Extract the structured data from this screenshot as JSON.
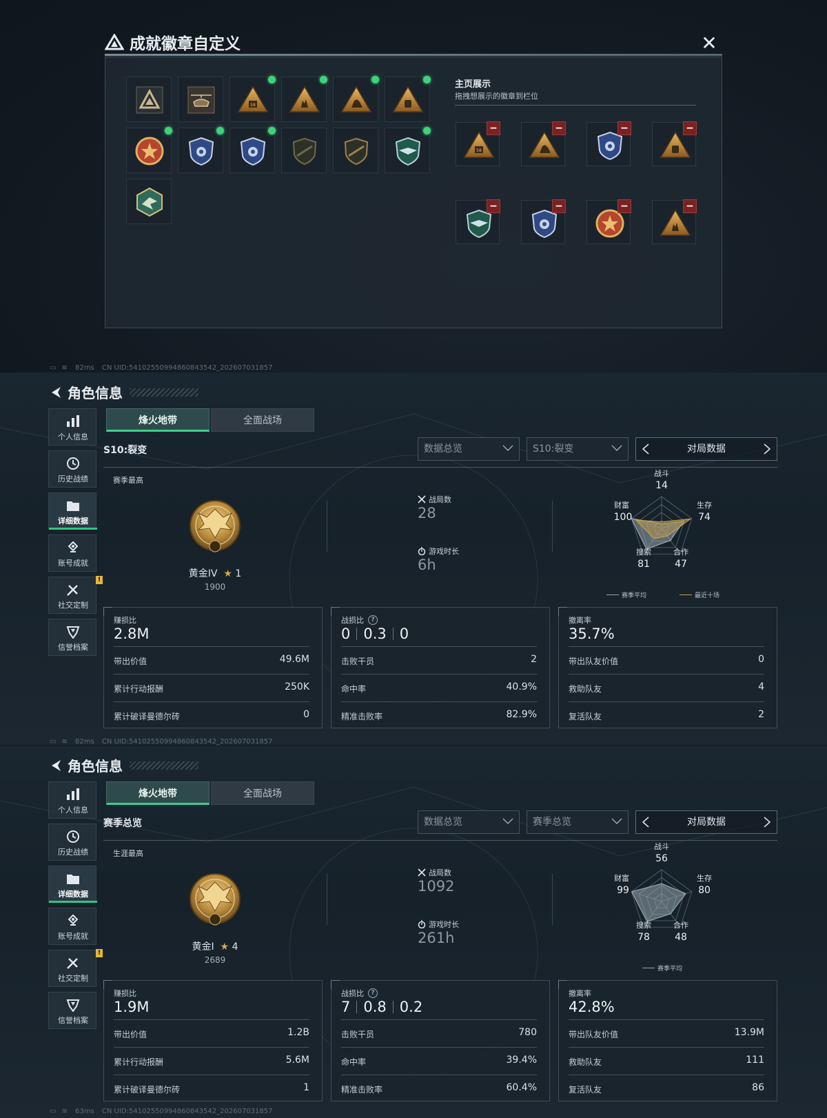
{
  "badge_dialog": {
    "title": "成就徽章自定义",
    "close_glyph": "✕",
    "showcase_title": "主页展示",
    "showcase_hint": "拖拽想展示的徽章到栏位",
    "owned": [
      {
        "icon": "triangle-emblem-icon",
        "equipped": false
      },
      {
        "icon": "helicopter-emblem-icon",
        "equipped": false
      },
      {
        "icon": "backpack-58-triangle-icon",
        "equipped": true
      },
      {
        "icon": "hand-sign-triangle-icon",
        "equipped": true
      },
      {
        "icon": "soldier-triangle-icon",
        "equipped": true
      },
      {
        "icon": "armor-triangle-icon",
        "equipped": true
      },
      {
        "icon": "star-medal-icon",
        "equipped": true
      },
      {
        "icon": "blue-shield-icon",
        "equipped": true
      },
      {
        "icon": "blue-shield-wings-icon",
        "equipped": true
      },
      {
        "icon": "rifle-shield-icon",
        "equipped": false
      },
      {
        "icon": "rifle-shield-gold-icon",
        "equipped": false
      },
      {
        "icon": "green-wings-shield-icon",
        "equipped": true
      },
      {
        "icon": "green-hex-bird-icon",
        "equipped": false
      }
    ],
    "display_slots": [
      "backpack-58-triangle-icon",
      "soldier-triangle-icon",
      "blue-shield-wings-icon",
      "armor-triangle-icon",
      "green-wings-shield-icon",
      "blue-shield-icon",
      "star-medal-icon",
      "hand-sign-triangle-icon"
    ],
    "remove_glyph": "−"
  },
  "status_bars": [
    {
      "ping": "82ms",
      "uid": "CN UID:5410255099486084354​2_202607031857"
    },
    {
      "ping": "82ms",
      "uid": "CN UID:54102550994860843542_202607031857"
    },
    {
      "ping": "63ms",
      "uid": "CN UID:54102550994860843542_202607031857"
    }
  ],
  "colors": {
    "accent": "#2fc783",
    "gold": "#d5a948",
    "danger": "#7a2222",
    "radar_season": "#9aa6ae",
    "radar_recent": "#c9a24a"
  },
  "panes": [
    {
      "header_title": "角色信息",
      "nav": [
        "个人信息",
        "历史战绩",
        "详细数据",
        "账号成就",
        "社交定制",
        "信誉档案"
      ],
      "nav_active": 2,
      "tabs": [
        "烽火地带",
        "全面战场"
      ],
      "section_title": "S10:裂变",
      "dropdown1": "数据总览",
      "dropdown2": "S10:裂变",
      "pager_label": "对局数据",
      "best_label": "赛季最高",
      "rank_name": "黄金IV",
      "rank_stars": "1",
      "rank_score": "1900",
      "matches_label": "战局数",
      "matches_value": "28",
      "playtime_label": "游戏时长",
      "playtime_value": "6h",
      "radar": {
        "axes": [
          "战斗",
          "生存",
          "合作",
          "搜索",
          "财富"
        ],
        "values": [
          "14",
          "74",
          "47",
          "81",
          "100"
        ],
        "season": [
          14,
          74,
          47,
          81,
          100
        ],
        "recent": [
          20,
          95,
          30,
          40,
          85
        ],
        "legend": [
          "赛季平均",
          "最近十场"
        ]
      },
      "cards": [
        {
          "title": "赚损比",
          "value": "2.8M",
          "rows": [
            [
              "带出价值",
              "49.6M"
            ],
            [
              "累计行动报酬",
              "250K"
            ],
            [
              "累计破译曼德尔砖",
              "0"
            ]
          ]
        },
        {
          "title": "战损比",
          "trio": [
            "0",
            "0.3",
            "0"
          ],
          "rows": [
            [
              "击败干员",
              "2"
            ],
            [
              "命中率",
              "40.9%"
            ],
            [
              "精准击败率",
              "82.9%"
            ]
          ]
        },
        {
          "title": "撤离率",
          "value": "35.7%",
          "rows": [
            [
              "带出队友价值",
              "0"
            ],
            [
              "救助队友",
              "4"
            ],
            [
              "复活队友",
              "2"
            ]
          ]
        }
      ]
    },
    {
      "header_title": "角色信息",
      "nav": [
        "个人信息",
        "历史战绩",
        "详细数据",
        "账号成就",
        "社交定制",
        "信誉档案"
      ],
      "nav_active": 2,
      "tabs": [
        "烽火地带",
        "全面战场"
      ],
      "section_title": "赛季总览",
      "dropdown1": "数据总览",
      "dropdown2": "赛季总览",
      "pager_label": "对局数据",
      "best_label": "生涯最高",
      "rank_name": "黄金I",
      "rank_stars": "4",
      "rank_score": "2689",
      "matches_label": "战局数",
      "matches_value": "1092",
      "playtime_label": "游戏时长",
      "playtime_value": "261h",
      "radar": {
        "axes": [
          "战斗",
          "生存",
          "合作",
          "搜索",
          "财富"
        ],
        "values": [
          "56",
          "80",
          "48",
          "78",
          "99"
        ],
        "season": [
          56,
          80,
          48,
          78,
          99
        ],
        "recent": [],
        "legend": [
          "赛季平均"
        ]
      },
      "cards": [
        {
          "title": "赚损比",
          "value": "1.9M",
          "rows": [
            [
              "带出价值",
              "1.2B"
            ],
            [
              "累计行动报酬",
              "5.6M"
            ],
            [
              "累计破译曼德尔砖",
              "1"
            ]
          ]
        },
        {
          "title": "战损比",
          "trio": [
            "7",
            "0.8",
            "0.2"
          ],
          "rows": [
            [
              "击败干员",
              "780"
            ],
            [
              "命中率",
              "39.4%"
            ],
            [
              "精准击败率",
              "60.4%"
            ]
          ]
        },
        {
          "title": "撤离率",
          "value": "42.8%",
          "rows": [
            [
              "带出队友价值",
              "13.9M"
            ],
            [
              "救助队友",
              "111"
            ],
            [
              "复活队友",
              "86"
            ]
          ]
        }
      ]
    }
  ]
}
